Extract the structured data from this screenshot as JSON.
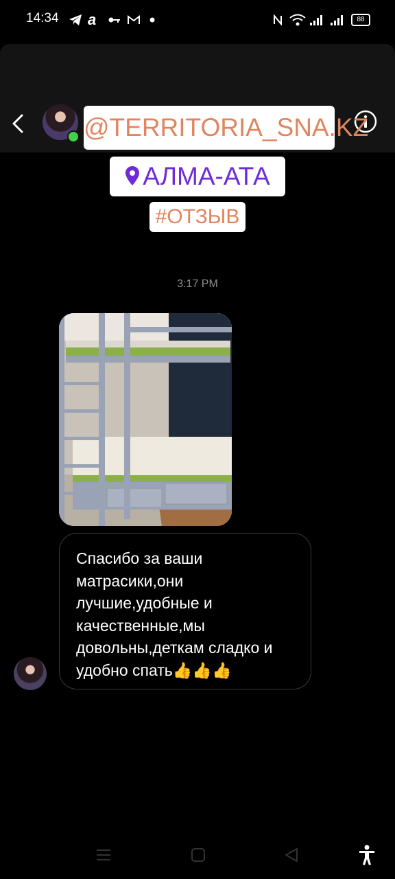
{
  "status_bar": {
    "time": "14:34",
    "battery": "88",
    "notification_icons": [
      "telegram-icon",
      "app-a-icon",
      "key-icon",
      "gmail-icon",
      "dot-icon"
    ],
    "system_icons": [
      "nfc-icon",
      "wifi-icon",
      "signal-icon",
      "signal-icon"
    ]
  },
  "header": {
    "back_icon": "chevron-left-icon",
    "info_icon": "info-icon"
  },
  "stickers": {
    "handle": "@TERRITORIA_SNA.KZ",
    "location": "АЛМА-АТА",
    "hashtag": "#ОТЗЫВ"
  },
  "chat": {
    "timestamp": "3:17 PM",
    "message_text": "Спасибо за ваши матрасики,они лучшие,удобные и качественные,мы довольны,деткам сладко и удобно спать👍👍👍"
  },
  "nav": [
    "menu-icon",
    "home-icon",
    "back-triangle-icon",
    "accessibility-icon"
  ],
  "colors": {
    "background": "#000000",
    "online": "#3fd14a",
    "handle_text": "#e0855f",
    "location_text": "#6f2bd8"
  }
}
